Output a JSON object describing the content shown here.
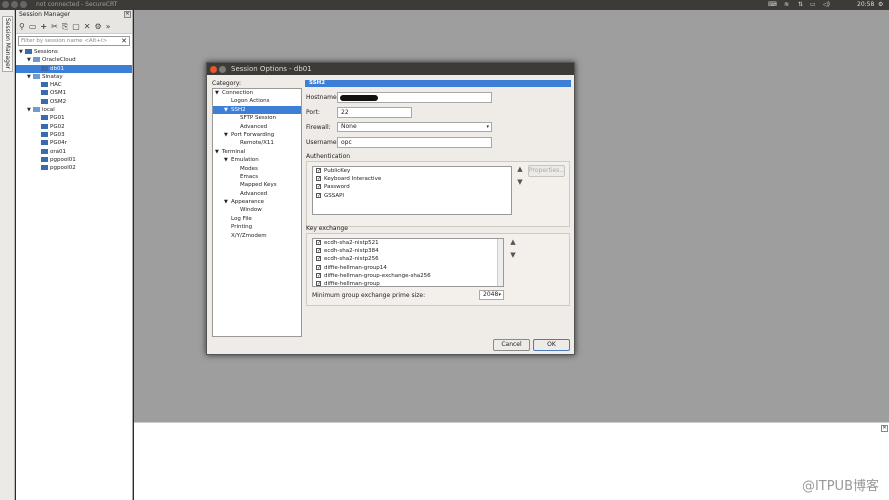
{
  "topbar": {
    "title": "not connected - SecureCRT",
    "time": "20:58"
  },
  "vertical_tab": {
    "label": "Session Manager"
  },
  "session_manager": {
    "title": "Session Manager",
    "search_placeholder": "Filter by session name <Alt+I>",
    "tree": [
      {
        "label": "Sessions",
        "level": 0,
        "arrow": "▼",
        "folder": false
      },
      {
        "label": "OracleCloud",
        "level": 1,
        "arrow": "▼",
        "folder": true
      },
      {
        "label": "db01",
        "level": 2,
        "arrow": "",
        "folder": false,
        "selected": true
      },
      {
        "label": "Sinatay",
        "level": 1,
        "arrow": "▼",
        "folder": true
      },
      {
        "label": "HAC",
        "level": 2,
        "arrow": "",
        "folder": false
      },
      {
        "label": "OSM1",
        "level": 2,
        "arrow": "",
        "folder": false
      },
      {
        "label": "OSM2",
        "level": 2,
        "arrow": "",
        "folder": false
      },
      {
        "label": "local",
        "level": 1,
        "arrow": "▼",
        "folder": true
      },
      {
        "label": "PG01",
        "level": 2,
        "arrow": "",
        "folder": false
      },
      {
        "label": "PG02",
        "level": 2,
        "arrow": "",
        "folder": false
      },
      {
        "label": "PG03",
        "level": 2,
        "arrow": "",
        "folder": false
      },
      {
        "label": "PG04r",
        "level": 2,
        "arrow": "",
        "folder": false
      },
      {
        "label": "ora01",
        "level": 2,
        "arrow": "",
        "folder": false
      },
      {
        "label": "pgpool01",
        "level": 2,
        "arrow": "",
        "folder": false
      },
      {
        "label": "pgpool02",
        "level": 2,
        "arrow": "",
        "folder": false
      }
    ]
  },
  "dialog": {
    "title": "Session Options - db01",
    "category_label": "Category:",
    "categories": [
      {
        "label": "Connection",
        "level": 0,
        "arrow": "▼"
      },
      {
        "label": "Logon Actions",
        "level": 1,
        "arrow": ""
      },
      {
        "label": "SSH2",
        "level": 1,
        "arrow": "▼",
        "selected": true
      },
      {
        "label": "SFTP Session",
        "level": 2,
        "arrow": ""
      },
      {
        "label": "Advanced",
        "level": 2,
        "arrow": ""
      },
      {
        "label": "Port Forwarding",
        "level": 1,
        "arrow": "▼"
      },
      {
        "label": "Remote/X11",
        "level": 2,
        "arrow": ""
      },
      {
        "label": "Terminal",
        "level": 0,
        "arrow": "▼"
      },
      {
        "label": "Emulation",
        "level": 1,
        "arrow": "▼"
      },
      {
        "label": "Modes",
        "level": 2,
        "arrow": ""
      },
      {
        "label": "Emacs",
        "level": 2,
        "arrow": ""
      },
      {
        "label": "Mapped Keys",
        "level": 2,
        "arrow": ""
      },
      {
        "label": "Advanced",
        "level": 2,
        "arrow": ""
      },
      {
        "label": "Appearance",
        "level": 1,
        "arrow": "▼"
      },
      {
        "label": "Window",
        "level": 2,
        "arrow": ""
      },
      {
        "label": "Log File",
        "level": 1,
        "arrow": ""
      },
      {
        "label": "Printing",
        "level": 1,
        "arrow": ""
      },
      {
        "label": "X/Y/Zmodem",
        "level": 1,
        "arrow": ""
      }
    ],
    "panel": {
      "header": "SSH2",
      "hostname_label": "Hostname:",
      "hostname_value": "",
      "port_label": "Port:",
      "port_value": "22",
      "firewall_label": "Firewall:",
      "firewall_value": "None",
      "username_label": "Username:",
      "username_value": "opc",
      "auth_label": "Authentication",
      "auth_items": [
        "PublicKey",
        "Keyboard Interactive",
        "Password",
        "GSSAPI"
      ],
      "properties_button": "Properties...",
      "kex_label": "Key exchange",
      "kex_items": [
        "ecdh-sha2-nistp521",
        "ecdh-sha2-nistp384",
        "ecdh-sha2-nistp256",
        "diffie-hellman-group14",
        "diffie-hellman-group-exchange-sha256",
        "diffie-hellman-group"
      ],
      "min_group_label": "Minimum group exchange prime size:",
      "min_group_value": "2048"
    },
    "cancel_button": "Cancel",
    "ok_button": "OK"
  },
  "watermark": "@ITPUB博客"
}
